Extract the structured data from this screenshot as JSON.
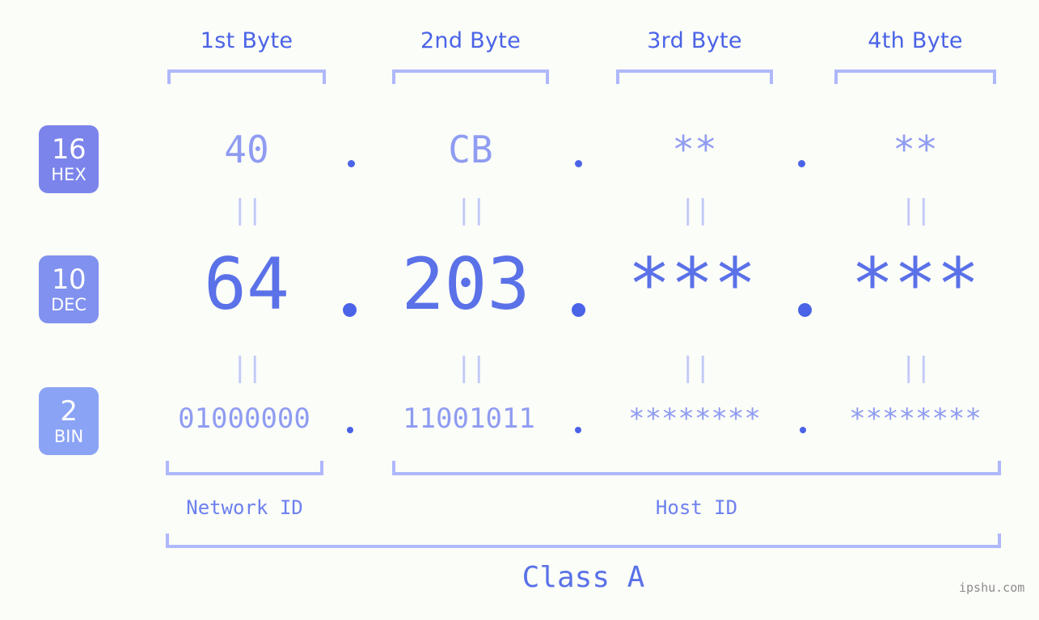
{
  "background_color": "#fbfdf8",
  "accent_color": "#4a63e7",
  "bracket_color": "#aeb8fb",
  "byte_headers": [
    {
      "label": "1st Byte"
    },
    {
      "label": "2nd Byte"
    },
    {
      "label": "3rd Byte"
    },
    {
      "label": "4th Byte"
    }
  ],
  "rows": {
    "hex": {
      "badge_number": "16",
      "badge_abbr": "HEX",
      "badge_color": "#7b84ea",
      "values": [
        "40",
        "CB",
        "**",
        "**"
      ],
      "separator": "."
    },
    "dec": {
      "badge_number": "10",
      "badge_abbr": "DEC",
      "badge_color": "#8091ef",
      "values": [
        "64",
        "203",
        "***",
        "***"
      ],
      "separator": "."
    },
    "bin": {
      "badge_number": "2",
      "badge_abbr": "BIN",
      "badge_color": "#8aa3f5",
      "values": [
        "01000000",
        "11001011",
        "********",
        "********"
      ],
      "separator": "."
    }
  },
  "equals_marks": {
    "glyph": "||",
    "hex_to_dec_count": 4,
    "dec_to_bin_count": 4
  },
  "sections": {
    "network_id": "Network ID",
    "host_id": "Host ID",
    "class": "Class A"
  },
  "watermark": "ipshu.com"
}
